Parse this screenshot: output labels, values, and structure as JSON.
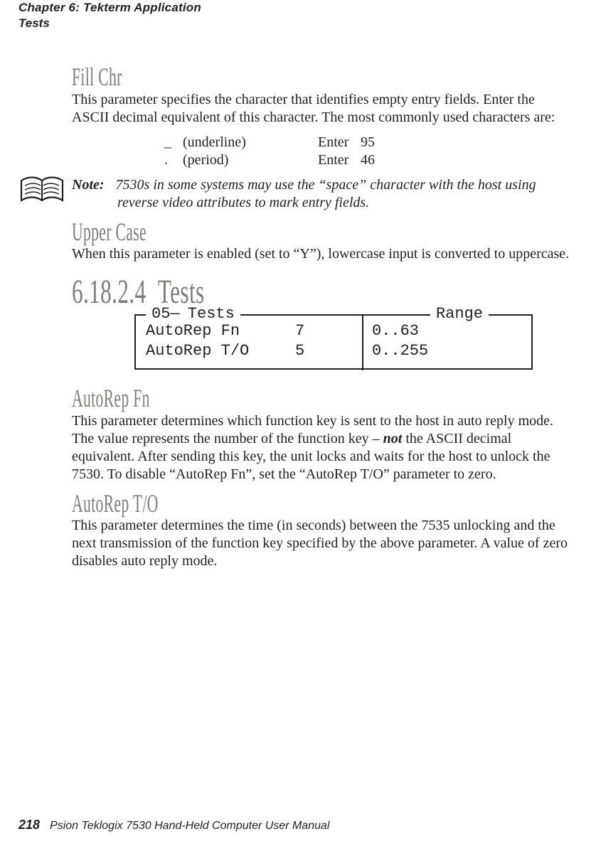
{
  "header": {
    "line1": "Chapter  6:   Tekterm Application",
    "line2": "Tests"
  },
  "sections": {
    "fill_chr": {
      "title": "Fill Chr",
      "para": "This parameter specifies the character that identifies empty entry fields. Enter the ASCII decimal equivalent of this character. The most commonly used characters are:"
    },
    "char_table": [
      {
        "sym": "_",
        "desc": "(underline)",
        "enter": "Enter",
        "val": "95"
      },
      {
        "sym": ".",
        "desc": "(period)",
        "enter": "Enter",
        "val": "46"
      }
    ],
    "note": {
      "label": "Note:",
      "text_line1": "7530s in some systems may use the “space” character with the host using",
      "text_line2": "reverse video attributes to mark entry fields."
    },
    "upper_case": {
      "title": "Upper Case",
      "para": "When this parameter is enabled (set to “Y”), lowercase input is converted to uppercase."
    },
    "tests_heading": {
      "num": "6.18.2.4",
      "title": "Tests"
    },
    "tests_box": {
      "legend_left_prefix": "05",
      "legend_left_dash": "—",
      "legend_left_suffix": " Tests",
      "legend_right": "Range",
      "rows": [
        {
          "name": "AutoRep Fn",
          "value": "7",
          "range": "0..63"
        },
        {
          "name": "AutoRep T/O",
          "value": "5",
          "range": "0..255"
        }
      ]
    },
    "autorep_fn": {
      "title": "AutoRep Fn",
      "para_pre_bold": "This parameter determines which function key is sent to the host in auto reply mode. The value represents the number of the function key – ",
      "para_bold": "not",
      "para_post_bold": " the ASCII decimal equivalent. After sending this key, the unit locks and waits for the host to unlock the 7530. To disable “AutoRep Fn”, set the “AutoRep T/O” parameter to zero."
    },
    "autorep_to": {
      "title": "AutoRep T/O",
      "para": "This parameter determines the time (in seconds) between the 7535 unlocking and the next transmission of the function key specified by the above parameter. A value of zero disables auto reply mode."
    }
  },
  "footer": {
    "pagenum": "218",
    "text": "Psion Teklogix 7530 Hand-Held Computer User Manual"
  }
}
